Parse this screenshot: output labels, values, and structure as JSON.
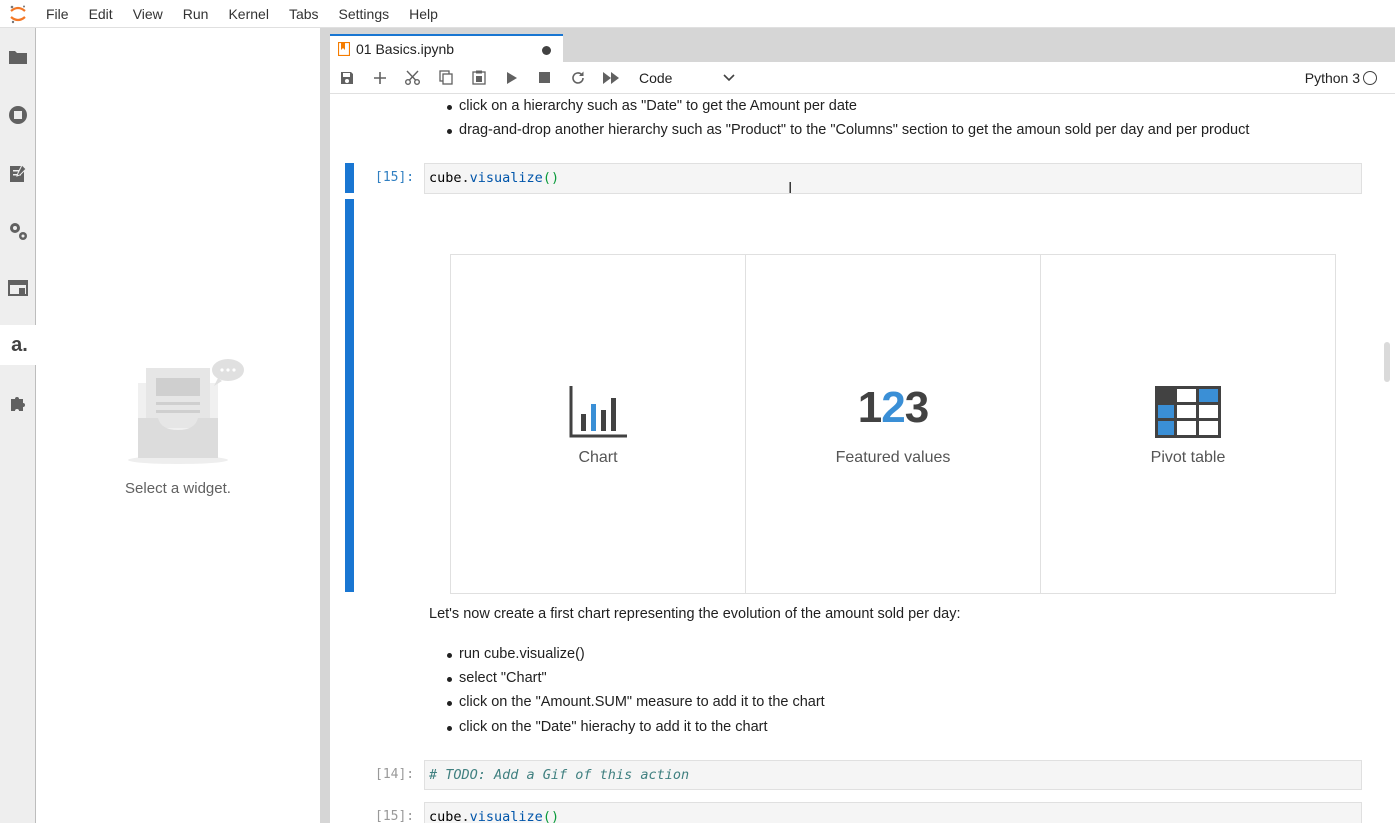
{
  "menu": [
    "File",
    "Edit",
    "View",
    "Run",
    "Kernel",
    "Tabs",
    "Settings",
    "Help"
  ],
  "sidebar": {
    "icons": [
      "folder-icon",
      "running-icon",
      "commands-icon",
      "property-inspector-icon",
      "tabs-icon",
      "atoti-icon",
      "extension-icon"
    ],
    "empty_message": "Select a widget."
  },
  "tab": {
    "title": "01 Basics.ipynb"
  },
  "toolbar": {
    "cell_type": "Code",
    "kernel": "Python 3"
  },
  "notebook": {
    "top_bullets": [
      "click on a hierarchy such as \"Date\" to get the Amount per date",
      "drag-and-drop another hierarchy such as \"Product\" to the \"Columns\" section to get the amoun sold per day and per product"
    ],
    "cell1": {
      "prompt": "[15]:",
      "code_var": "cube",
      "code_dot": ".",
      "code_fn": "visualize",
      "code_paren": "()"
    },
    "widget_options": [
      "Chart",
      "Featured values",
      "Pivot table"
    ],
    "featured_number": {
      "a": "1",
      "b": "2",
      "c": "3"
    },
    "paragraph": "Let's now create a first chart representing the evolution of the amount sold per day:",
    "bullets": [
      "run cube.visualize()",
      "select \"Chart\"",
      "click on the \"Amount.SUM\" measure to add it to the chart",
      "click on the \"Date\" hierachy to add it to the chart"
    ],
    "cell2": {
      "prompt": "[14]:",
      "code": "# TODO: Add a Gif of this action"
    },
    "cell3": {
      "prompt": "[15]:",
      "code_var": "cube",
      "code_dot": ".",
      "code_fn": "visualize",
      "code_paren": "()"
    }
  }
}
